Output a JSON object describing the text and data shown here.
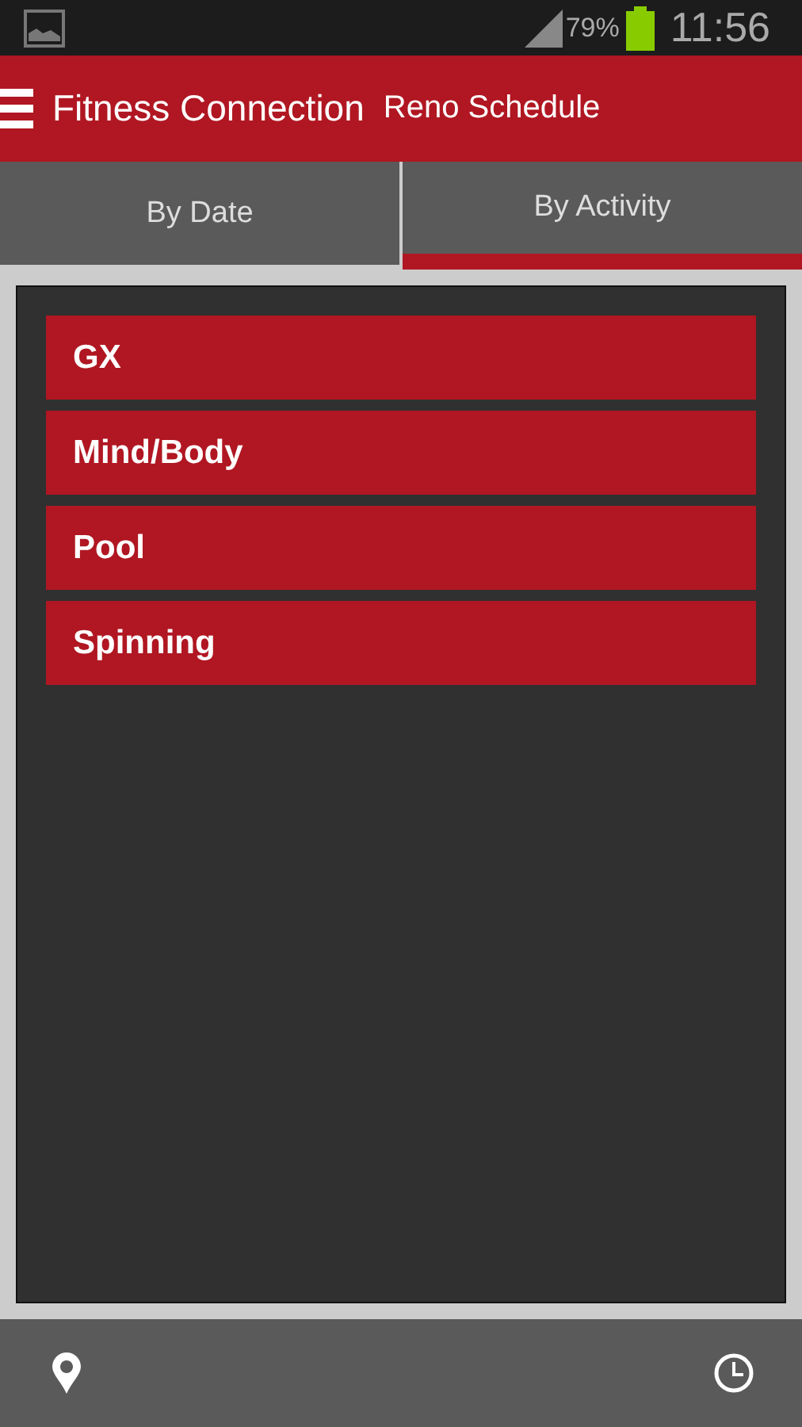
{
  "status_bar": {
    "battery": "79%",
    "time": "11:56"
  },
  "app_bar": {
    "title": "Fitness Connection",
    "subtitle": "Reno Schedule"
  },
  "tabs": [
    {
      "label": "By Date",
      "selected": false
    },
    {
      "label": "By Activity",
      "selected": true
    }
  ],
  "activities": [
    {
      "label": "GX"
    },
    {
      "label": "Mind/Body"
    },
    {
      "label": "Pool"
    },
    {
      "label": "Spinning"
    }
  ]
}
